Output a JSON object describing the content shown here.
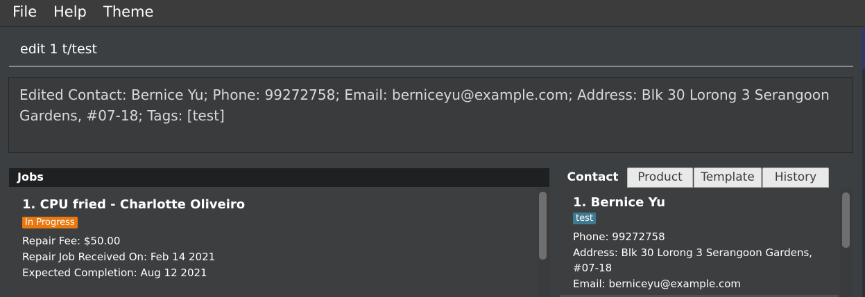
{
  "menu": {
    "file": "File",
    "help": "Help",
    "theme": "Theme"
  },
  "command": {
    "value": "edit 1 t/test"
  },
  "result": {
    "text": "Edited Contact: Bernice Yu; Phone: 99272758; Email: berniceyu@example.com; Address: Blk 30 Lorong 3 Serangoon Gardens, #07-18; Tags: [test]"
  },
  "jobs": {
    "header": "Jobs",
    "items": [
      {
        "title": "1. CPU fried - Charlotte Oliveiro",
        "status": "In Progress",
        "status_color": "#e8780f",
        "fee": "Repair Fee: $50.00",
        "received": "Repair Job Received On: Feb 14 2021",
        "completion": "Expected Completion: Aug 12 2021"
      }
    ]
  },
  "tabs": [
    {
      "label": "Contact",
      "active": true
    },
    {
      "label": "Product",
      "active": false
    },
    {
      "label": "Template",
      "active": false
    },
    {
      "label": "History",
      "active": false
    }
  ],
  "contacts": [
    {
      "title": "1.  Bernice Yu",
      "tag": "test",
      "tag_color": "#3e7b91",
      "phone": "Phone: 99272758",
      "address_line1": "Address: Blk 30 Lorong 3 Serangoon Gardens,",
      "address_line2": "#07-18",
      "email": "Email: berniceyu@example.com"
    }
  ]
}
